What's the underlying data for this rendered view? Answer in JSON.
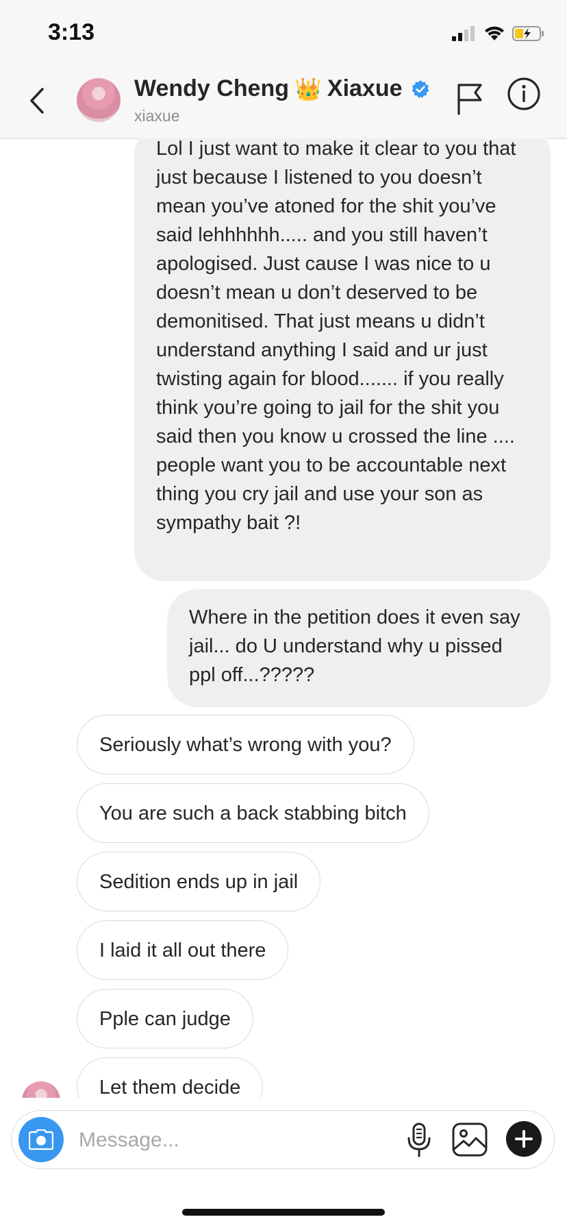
{
  "status_bar": {
    "time": "3:13"
  },
  "header": {
    "title": "Wendy Cheng",
    "title_emoji": "👑",
    "title_suffix": "Xiaxue",
    "username": "xiaxue",
    "verified_color": "#3897f0"
  },
  "messages": {
    "sent": [
      {
        "text": "Lol I just want to make it clear to you that just because I listened to you doesn’t mean you’ve atoned for the shit you’ve said lehhhhhh..... and you still haven’t apologised. Just cause I was nice to u doesn’t mean u don’t deserved to be demonitised. That just means u didn’t understand anything I said and ur just twisting again for blood....... if you really think you’re going to jail for the shit you said then you know u crossed the line .... people want you to be accountable next thing you cry jail and use your son as sympathy bait ?!"
      },
      {
        "text": "Where in the petition does it even say jail... do U understand why u pissed ppl off...?????"
      }
    ],
    "received": [
      "Seriously what’s wrong with you?",
      "You are such a back stabbing bitch",
      "Sedition ends up in jail",
      "I laid it all out there",
      "Pple can judge",
      "Let them decide"
    ]
  },
  "composer": {
    "placeholder": "Message...",
    "camera_color": "#3897f0"
  },
  "icons": {
    "back": "chevron-left-icon",
    "flag": "flag-icon",
    "info": "info-icon",
    "camera": "camera-icon",
    "mic": "microphone-icon",
    "gallery": "image-icon",
    "plus": "plus-icon"
  }
}
